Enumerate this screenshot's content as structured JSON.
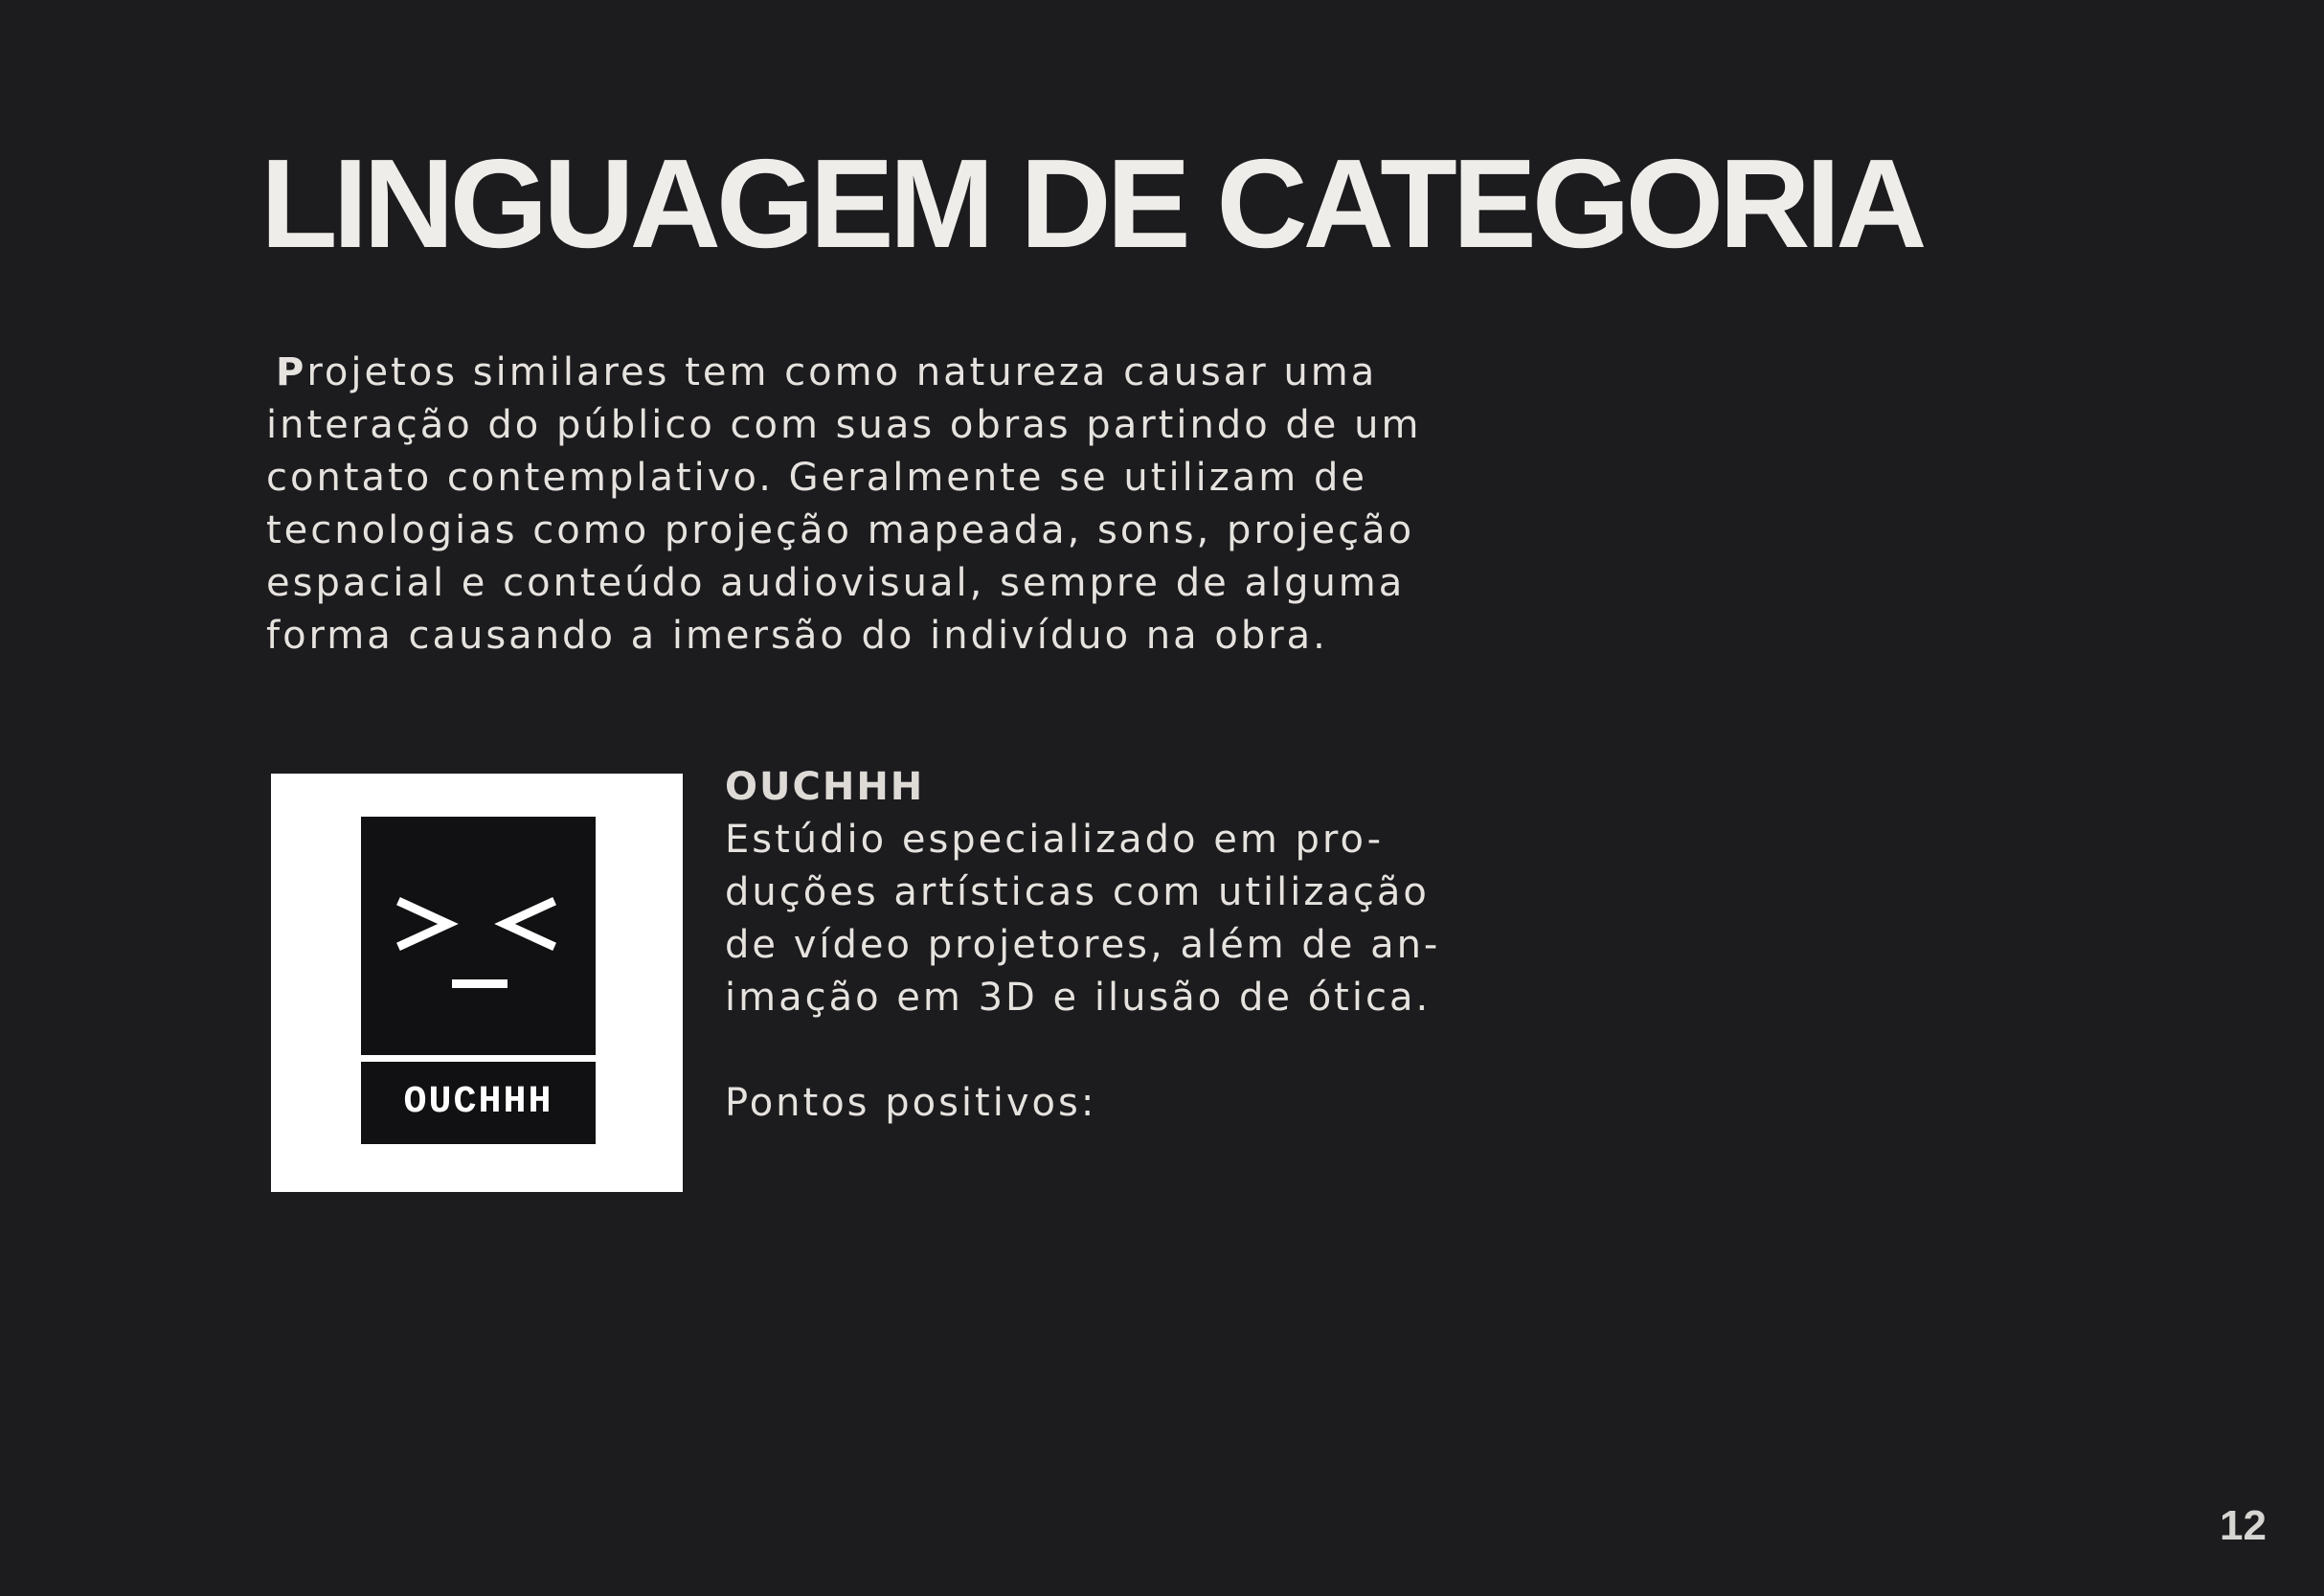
{
  "page": {
    "title": "LINGUAGEM DE CATEGORIA",
    "number": "12"
  },
  "intro": {
    "dropcap": "P",
    "lines": [
      "rojetos similares tem como natureza causar uma",
      "interação do público com suas obras partindo de um",
      "contato contemplativo. Geralmente se utilizam de",
      "tecnologias como projeção mapeada, sons, projeção",
      "espacial e conteúdo audiovisual, sempre de alguma",
      "forma causando a imersão do indivíduo na obra."
    ]
  },
  "studio": {
    "name": "OUCHHH",
    "description_lines": [
      "Estúdio especializado em pro-",
      "duções artísticas com utilização",
      "de vídeo projetores, além de an-",
      "imação em 3D e ilusão de ótica."
    ],
    "pros_label": "Pontos positivos:",
    "logo": {
      "wordmark": "OUCHHH",
      "face": ">_<",
      "icon": "ouchhh-logo"
    }
  },
  "colors": {
    "background": "#1c1b1e",
    "text": "#e9e7e4",
    "logo_card": "#ffffff",
    "logo_mark": "#111113"
  }
}
